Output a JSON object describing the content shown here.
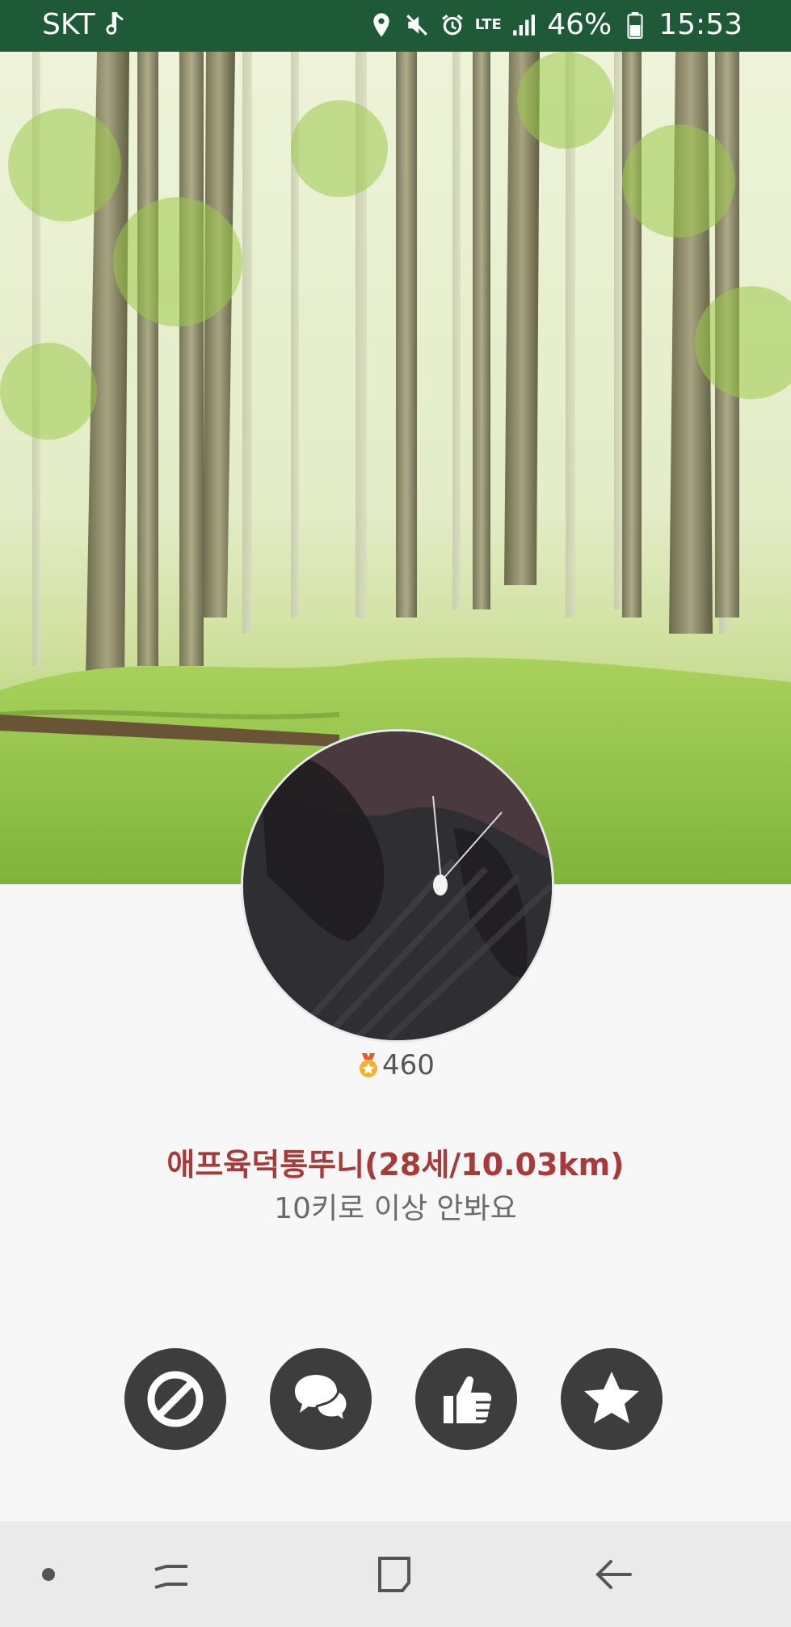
{
  "status_bar": {
    "carrier": "SKT",
    "battery": "46%",
    "time": "15:53",
    "network": "LTE",
    "icons": [
      "music-note-icon",
      "location-icon",
      "mute-icon",
      "alarm-icon",
      "lte-icon",
      "signal-icon",
      "battery-icon"
    ]
  },
  "profile": {
    "points": "460",
    "name_line": "애프육덕통뚜니(28세/10.03km)",
    "status_message": "10키로 이상 안봐요"
  },
  "actions": [
    {
      "name": "block-button",
      "icon": "block-icon"
    },
    {
      "name": "chat-button",
      "icon": "chat-bubbles-icon"
    },
    {
      "name": "like-button",
      "icon": "thumbs-up-icon"
    },
    {
      "name": "favorite-button",
      "icon": "star-icon"
    }
  ],
  "navigation": [
    "nav-dot",
    "recent-apps",
    "home",
    "back"
  ],
  "colors": {
    "status_bar": "#1f5a38",
    "name": "#a83a3a",
    "action_button": "#3d3d3d",
    "nav_bar": "#eaeaea"
  }
}
